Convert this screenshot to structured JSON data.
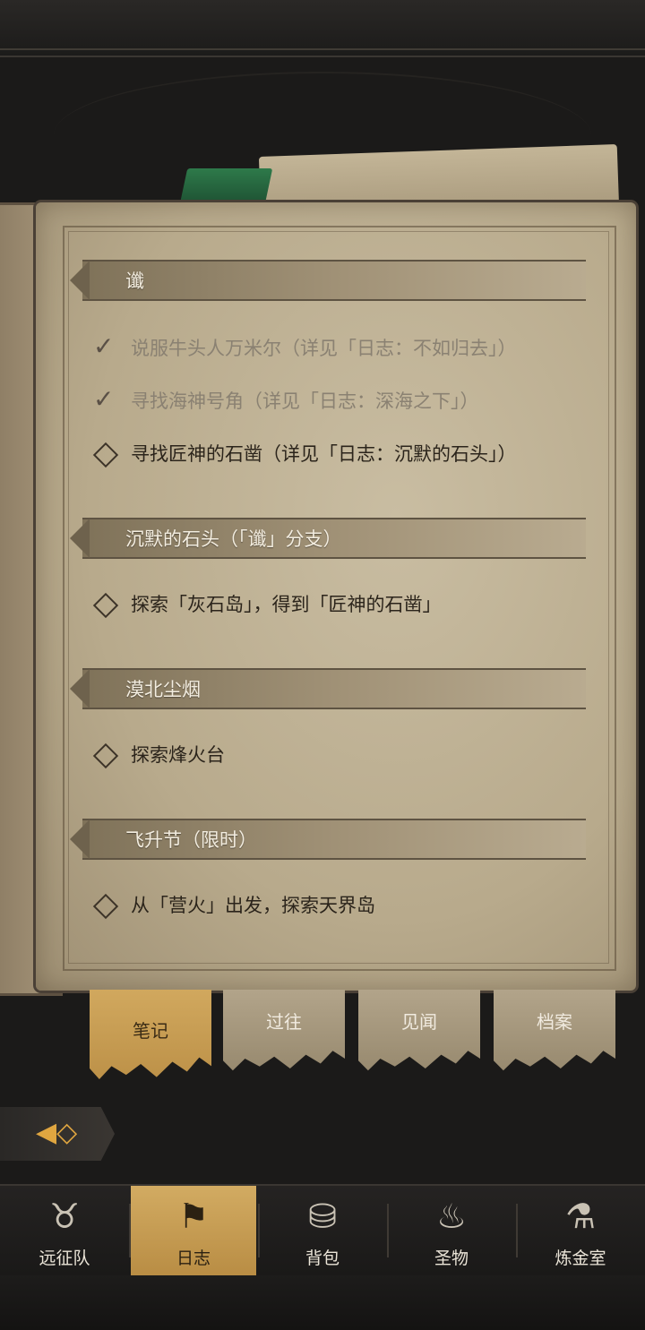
{
  "journal": {
    "sections": [
      {
        "title": "谶",
        "quests": [
          {
            "text": "说服牛头人万米尔（详见「日志：不如归去」）",
            "done": true
          },
          {
            "text": "寻找海神号角（详见「日志：深海之下」）",
            "done": true
          },
          {
            "text": "寻找匠神的石凿（详见「日志：沉默的石头」）",
            "done": false
          }
        ]
      },
      {
        "title": "沉默的石头（「谶」分支）",
        "quests": [
          {
            "text": "探索「灰石岛」，得到「匠神的石凿」",
            "done": false
          }
        ]
      },
      {
        "title": "漠北尘烟",
        "quests": [
          {
            "text": "探索烽火台",
            "done": false
          }
        ]
      },
      {
        "title": "飞升节（限时）",
        "quests": [
          {
            "text": "从「营火」出发，探索天界岛",
            "done": false
          }
        ]
      }
    ]
  },
  "tabs": [
    {
      "label": "笔记",
      "active": true
    },
    {
      "label": "过往",
      "active": false
    },
    {
      "label": "见闻",
      "active": false
    },
    {
      "label": "档案",
      "active": false
    }
  ],
  "bottom_nav": [
    {
      "label": "远征队",
      "icon": "horned-helmet-icon",
      "active": false
    },
    {
      "label": "日志",
      "icon": "journal-banner-icon",
      "active": true
    },
    {
      "label": "背包",
      "icon": "backpack-icon",
      "active": false
    },
    {
      "label": "圣物",
      "icon": "torch-relic-icon",
      "active": false
    },
    {
      "label": "炼金室",
      "icon": "alchemy-icon",
      "active": false
    }
  ],
  "colors": {
    "accent_gold": "#d1a85e",
    "parchment": "#c9bda2",
    "bookmark_green": "#2e7a4a"
  }
}
